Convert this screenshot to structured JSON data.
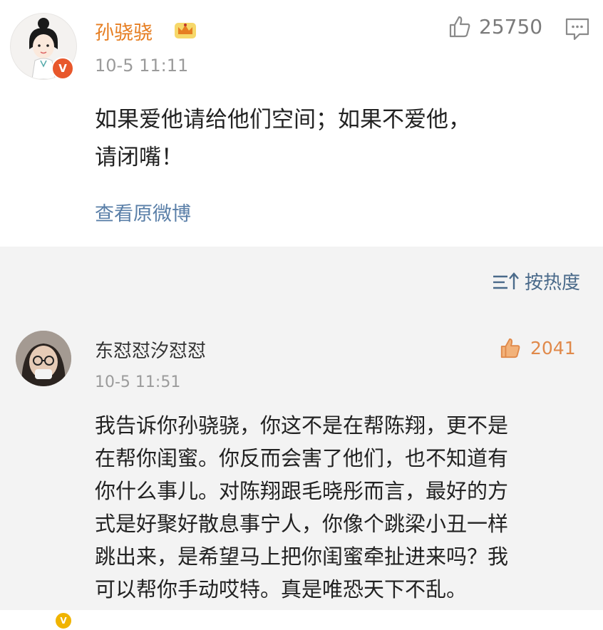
{
  "post": {
    "author": "孙骁骁",
    "timestamp": "10-5 11:11",
    "likes": "25750",
    "content_line1": "如果爱他请给他们空间；如果不爱他，",
    "content_line2": "请闭嘴！",
    "view_original": "查看原微博"
  },
  "sort": {
    "label": "按热度"
  },
  "comment": {
    "author": "东怼怼汐怼怼",
    "timestamp": "10-5 11:51",
    "likes": "2041",
    "lines": [
      "我告诉你孙骁骁，你这不是在帮陈翔，更不是",
      "在帮你闺蜜。你反而会害了他们，也不知道有",
      "你什么事儿。对陈翔跟毛晓彤而言，最好的方",
      "式是好聚好散息事宁人，你像个跳梁小丑一样",
      "跳出来，是希望马上把你闺蜜牵扯进来吗？我",
      "可以帮你手动哎特。真是唯恐天下不乱。"
    ]
  },
  "colors": {
    "author_vip": "#e67e22",
    "link": "#5a7fa8",
    "liked": "#e0894a",
    "verified_red": "#e8572b",
    "verified_yellow": "#f0b400"
  }
}
